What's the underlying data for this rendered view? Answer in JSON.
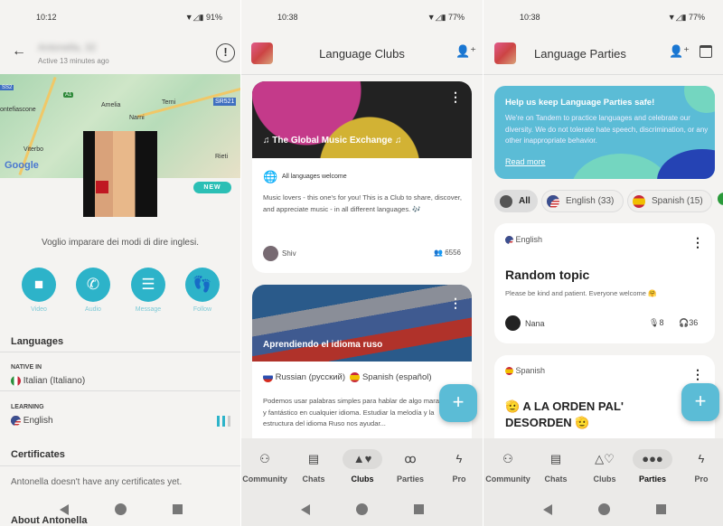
{
  "profile": {
    "status": {
      "time": "10:12",
      "battery": "91%"
    },
    "name": "Antonella, 32",
    "active": "Active 13 minutes ago",
    "map_labels": [
      "Amelia",
      "Terni",
      "Narni",
      "ontefiascone",
      "Viterbo",
      "Rieti",
      "A1",
      "SS2",
      "SR521"
    ],
    "map_logo": "Google",
    "badge": "NEW",
    "bio": "Voglio imparare dei modi di dire inglesi.",
    "actions": [
      {
        "label": "Video",
        "icon": "video-camera-icon"
      },
      {
        "label": "Audio",
        "icon": "phone-icon"
      },
      {
        "label": "Message",
        "icon": "message-icon"
      },
      {
        "label": "Follow",
        "icon": "footprints-icon"
      }
    ],
    "languages_title": "Languages",
    "native_label": "NATIVE IN",
    "native_language": "Italian (Italiano)",
    "learning_label": "LEARNING",
    "learning_language": "English",
    "learning_level": {
      "filled": 2,
      "total": 3
    },
    "certificates_title": "Certificates",
    "certificates_text": "Antonella doesn't have any certificates yet.",
    "about_title": "About Antonella"
  },
  "clubs": {
    "status": {
      "time": "10:38",
      "battery": "77%"
    },
    "title": "Language Clubs",
    "cards": [
      {
        "title": "♫ The Global Music Exchange ♫",
        "languages": "All languages welcome",
        "description": "Music lovers - this one's for you! This is a Club to share, discover, and appreciate music - in all different languages. 🎶",
        "host": "Shiv",
        "members": "6556"
      },
      {
        "title": "Aprendiendo el idioma ruso",
        "language1": "Russian (русский)",
        "language2": "Spanish (español)",
        "description": "Podemos usar palabras simples para hablar de algo maravilloso y fantástico en cualquier idioma. Estudiar la melodía y la estructura del idioma Ruso nos ayudar..."
      }
    ]
  },
  "parties": {
    "status": {
      "time": "10:38",
      "battery": "77%"
    },
    "title": "Language Parties",
    "banner": {
      "title": "Help us keep Language Parties safe!",
      "text": "We're on Tandem to practice languages and celebrate our diversity. We do not tolerate hate speech, discrimination, or any other inappropriate behavior.",
      "link": "Read more"
    },
    "chips": [
      {
        "label": "All",
        "selected": true
      },
      {
        "label": "English (33)"
      },
      {
        "label": "Spanish (15)"
      }
    ],
    "cards": [
      {
        "language": "English",
        "title": "Random topic",
        "subtitle": "Please be kind and patient. Everyone welcome 🤗",
        "host": "Nana",
        "speakers": "8",
        "listeners": "36"
      },
      {
        "language": "Spanish",
        "title": "🫡 A LA ORDEN PAL' DESORDEN 🫡"
      }
    ]
  },
  "nav": [
    {
      "label": "Community",
      "icon": "community-icon"
    },
    {
      "label": "Chats",
      "icon": "chat-icon"
    },
    {
      "label": "Clubs",
      "icon": "clubs-icon"
    },
    {
      "label": "Parties",
      "icon": "parties-icon"
    },
    {
      "label": "Pro",
      "icon": "lightning-icon"
    }
  ],
  "colors": {
    "accent": "#2db3c9",
    "fab": "#5bbcd6",
    "background": "#f4f3f1"
  }
}
